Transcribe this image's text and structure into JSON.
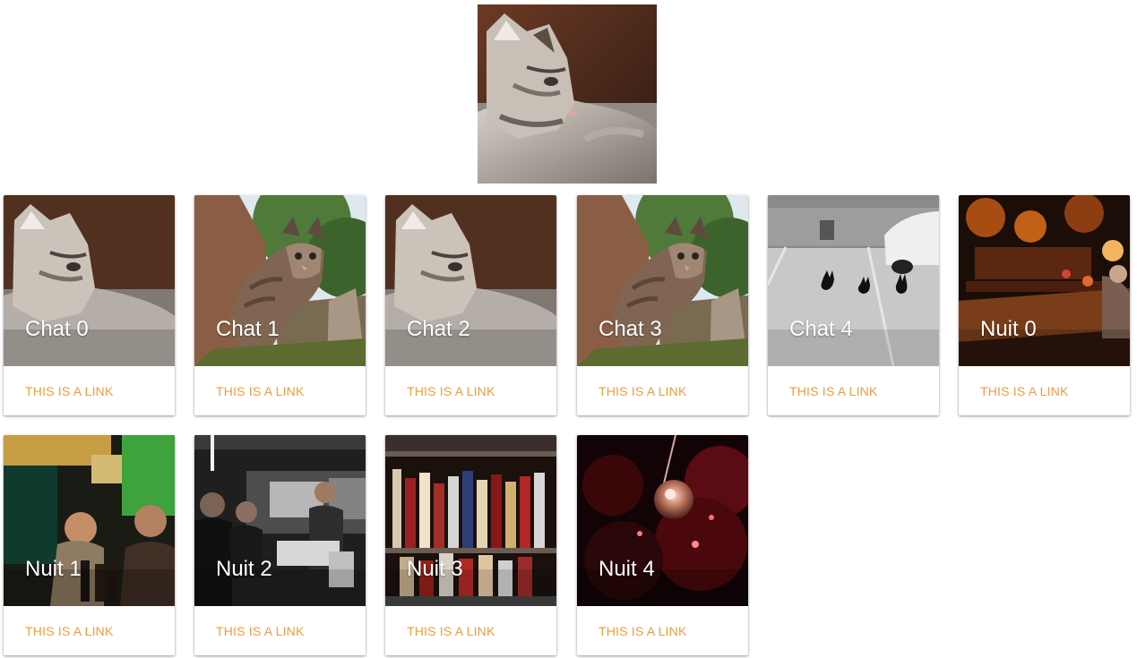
{
  "hero": {
    "image": "cat-in-profile-photo"
  },
  "cards": [
    {
      "title": "Chat 0",
      "link": "THIS IS A LINK",
      "image": "cat-in-profile-photo"
    },
    {
      "title": "Chat 1",
      "link": "THIS IS A LINK",
      "image": "tabby-cat-on-fence-photo"
    },
    {
      "title": "Chat 2",
      "link": "THIS IS A LINK",
      "image": "cat-in-profile-photo"
    },
    {
      "title": "Chat 3",
      "link": "THIS IS A LINK",
      "image": "tabby-cat-on-fence-photo"
    },
    {
      "title": "Chat 4",
      "link": "THIS IS A LINK",
      "image": "three-black-cats-parking-lot-photo"
    },
    {
      "title": "Nuit 0",
      "link": "THIS IS A LINK",
      "image": "warm-lit-bar-photo"
    },
    {
      "title": "Nuit 1",
      "link": "THIS IS A LINK",
      "image": "friends-at-bar-photo"
    },
    {
      "title": "Nuit 2",
      "link": "THIS IS A LINK",
      "image": "bartenders-photo"
    },
    {
      "title": "Nuit 3",
      "link": "THIS IS A LINK",
      "image": "liquor-bottles-photo"
    },
    {
      "title": "Nuit 4",
      "link": "THIS IS A LINK",
      "image": "disco-ball-photo"
    }
  ],
  "colors": {
    "link": "#ef9b3e",
    "title": "#ffffff"
  }
}
